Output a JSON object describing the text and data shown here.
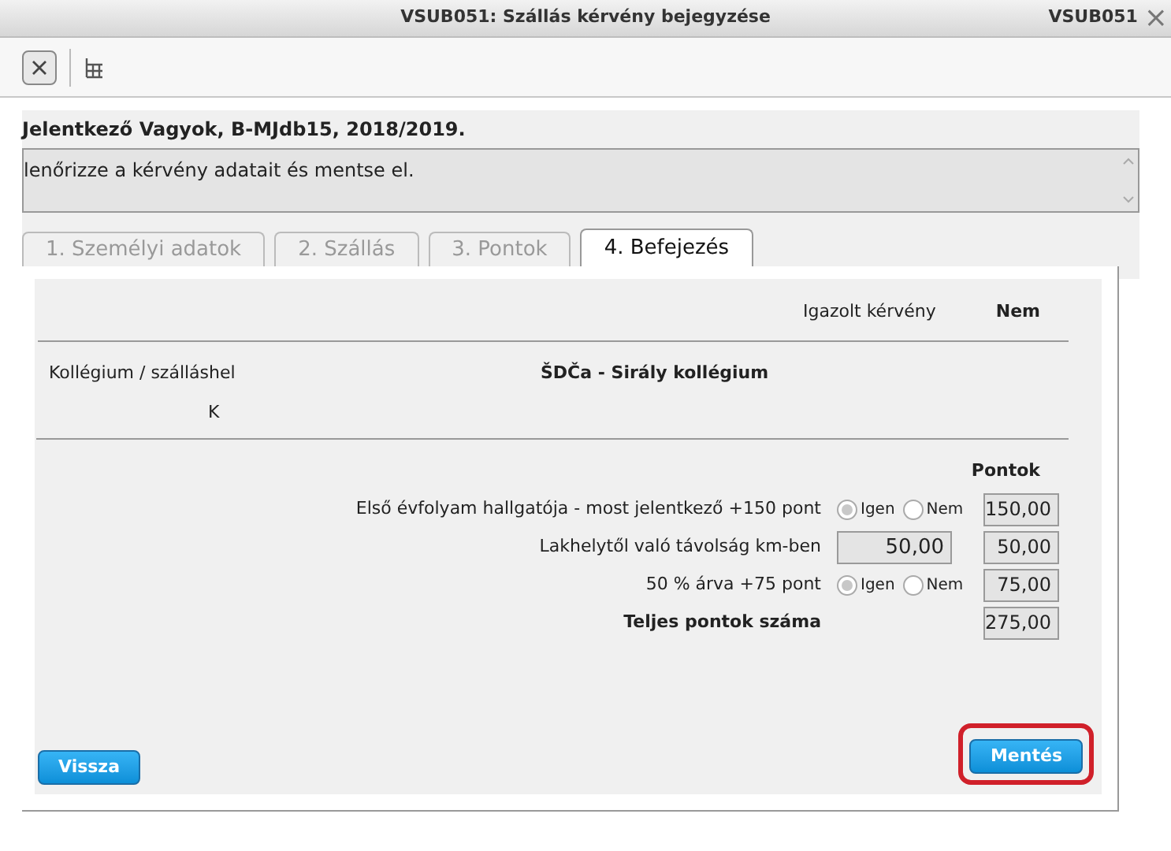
{
  "window": {
    "title": "VSUB051: Szállás kérvény bejegyzése",
    "code": "VSUB051",
    "close": "×"
  },
  "header": "Jelentkező Vagyok, B-MJdb15, 2018/2019.",
  "message": "lenőrizze a kérvény adatait és mentse el.",
  "tabs": [
    {
      "label": "1. Személyi adatok",
      "selected": false
    },
    {
      "label": "2. Szállás",
      "selected": false
    },
    {
      "label": "3. Pontok",
      "selected": false
    },
    {
      "label": "4. Befejezés",
      "selected": true
    }
  ],
  "verified": {
    "label": "Igazolt kérvény",
    "value": "Nem"
  },
  "dormitory": {
    "label": "Kollégium / szálláshel",
    "label_tail": "K",
    "value": "ŠDČa - Sirály kollégium"
  },
  "points_header": "Pontok",
  "rows": [
    {
      "kind": "radio",
      "label": "Első évfolyam hallgatója - most jelentkező +150 pont",
      "options": [
        {
          "label": "Igen",
          "selected": true
        },
        {
          "label": "Nem",
          "selected": false
        }
      ],
      "points": "150,00"
    },
    {
      "kind": "input",
      "label": "Lakhelytől való távolság km-ben",
      "value": "50,00",
      "points": "50,00"
    },
    {
      "kind": "radio",
      "label": "50 % árva +75 pont",
      "options": [
        {
          "label": "Igen",
          "selected": true
        },
        {
          "label": "Nem",
          "selected": false
        }
      ],
      "points": "75,00"
    },
    {
      "kind": "total",
      "label": "Teljes pontok száma",
      "points": "275,00"
    }
  ],
  "buttons": [
    {
      "label": "Vissza",
      "highlighted": false
    },
    {
      "label": "Mentés",
      "highlighted": true
    }
  ]
}
